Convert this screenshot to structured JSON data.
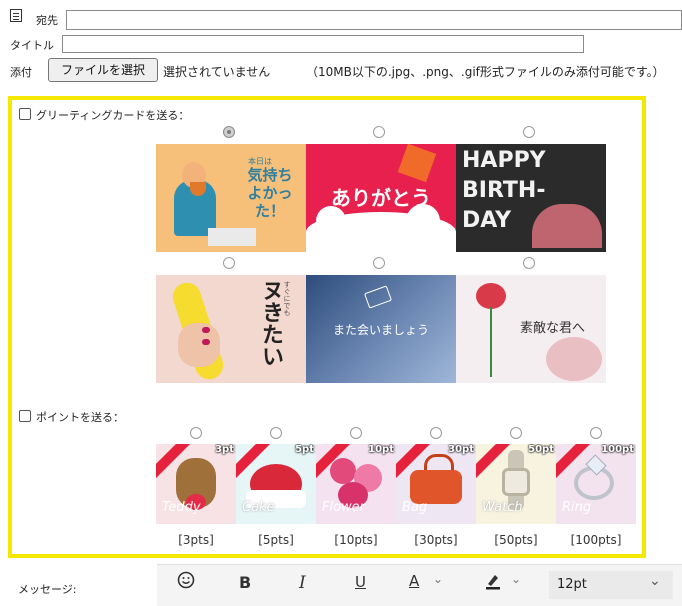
{
  "header": {
    "to_label": "宛先",
    "title_label": "タイトル",
    "attach_label": "添付",
    "file_button": "ファイルを選択",
    "file_status": "選択されていません",
    "file_note": "（10MB以下の.jpg、.png、.gif形式ファイルのみ添付可能です。）"
  },
  "greeting": {
    "label": "グリーティングカードを送る：",
    "cards": [
      {
        "text": "気持ち\nよかった！",
        "sub": "本日は",
        "bg": "#f7c07a"
      },
      {
        "text": "ありがとう",
        "bg": "#e8204e"
      },
      {
        "text": "HAPPY\nBIRTH-\nDAY",
        "bg": "#2b2b2b"
      },
      {
        "text": "ヌきたい",
        "sub": "すぐにでも",
        "bg": "#f3d8cf"
      },
      {
        "text": "また会いましょう",
        "bg": "#3f5f8f"
      },
      {
        "text": "素敵な君へ",
        "bg": "#f5eef0"
      }
    ]
  },
  "points": {
    "label": "ポイントを送る：",
    "items": [
      {
        "badge": "3pt",
        "label": "[3pts]",
        "script": "Teddy",
        "bg": "#f7e3e6"
      },
      {
        "badge": "5pt",
        "label": "[5pts]",
        "script": "Cake",
        "bg": "#e6f6f7"
      },
      {
        "badge": "10pt",
        "label": "[10pts]",
        "script": "Flower",
        "bg": "#f4e2f0"
      },
      {
        "badge": "30pt",
        "label": "[30pts]",
        "script": "Bag",
        "bg": "#efe6f4"
      },
      {
        "badge": "50pt",
        "label": "[50pts]",
        "script": "Watch",
        "bg": "#f7f3df"
      },
      {
        "badge": "100pt",
        "label": "[100pts]",
        "script": "Ring",
        "bg": "#f3e3ee"
      }
    ]
  },
  "message": {
    "label": "メッセージ:",
    "font_size": "12pt",
    "bold": "B",
    "italic": "I",
    "underline": "U",
    "font_color_letter": "A"
  }
}
